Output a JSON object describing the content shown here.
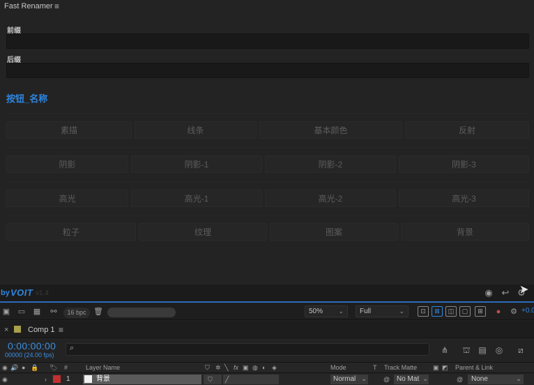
{
  "panel": {
    "title": "Fast Renamer",
    "prefix_label": "前缀",
    "suffix_label": "后缀",
    "group_title": "按钮_名称",
    "buttons": [
      [
        "素描",
        "线条",
        "基本颜色",
        "反射"
      ],
      [
        "阴影",
        "阴影-1",
        "阴影-2",
        "阴影-3"
      ],
      [
        "高光",
        "高光-1",
        "高光-2",
        "高光-3"
      ],
      [
        "粒子",
        "纹理",
        "图案",
        "背景"
      ]
    ],
    "brand_by": "by",
    "brand_logo": "VOIT",
    "version": "v1.4"
  },
  "viewer": {
    "bpc": "16 bpc",
    "zoom": "50%",
    "resolution": "Full",
    "exposure": "+0.0"
  },
  "timeline": {
    "comp_name": "Comp 1",
    "timecode": "0:00:00:00",
    "frames": "00000 (24.00 fps)",
    "search_placeholder": "",
    "headers": {
      "layer_number": "#",
      "layer_name": "Layer Name",
      "mode": "Mode",
      "t": "T",
      "track_matte": "Track Matte",
      "parent_link": "Parent & Link"
    },
    "layer": {
      "number": "1",
      "name": "背景",
      "mode": "Normal",
      "track_matte": "No Mat",
      "parent": "None"
    }
  },
  "colors": {
    "accent": "#2f86e0",
    "layer_label": "#c03030",
    "comp_swatch": "#a8a04a"
  }
}
